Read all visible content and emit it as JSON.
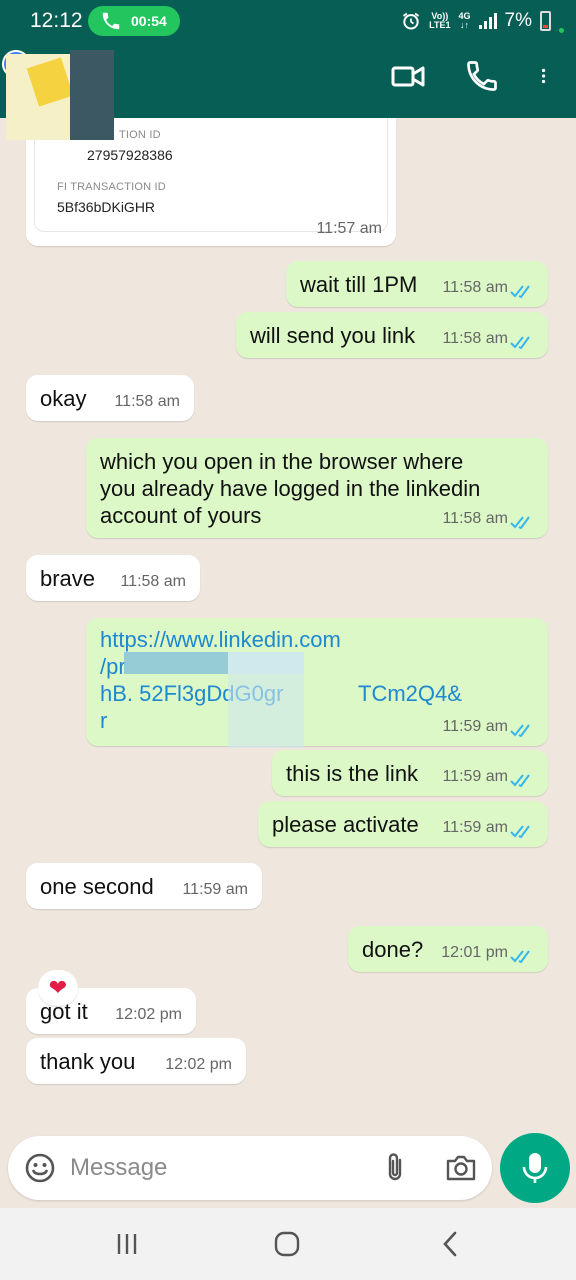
{
  "status_bar": {
    "time": "12:12",
    "call_duration": "00:54",
    "network_top": "Vo))",
    "network_bottom": "LTE1",
    "net_type": "4G",
    "battery": "7%"
  },
  "header": {
    "contact_name": "",
    "icons": [
      "back-icon",
      "video-call-icon",
      "voice-call-icon",
      "more-options-icon"
    ]
  },
  "transaction_card": {
    "label1": "TION ID",
    "value1": "27957928386",
    "label2": "FI TRANSACTION ID",
    "value2": "5Bf36bDKiGHR",
    "time": "11:57 am"
  },
  "messages": [
    {
      "dir": "out",
      "text": "wait till 1PM",
      "time": "11:58 am"
    },
    {
      "dir": "out",
      "text": "will send you link",
      "time": "11:58 am"
    },
    {
      "dir": "in",
      "text": "okay",
      "time": "11:58 am"
    },
    {
      "dir": "out",
      "text": "which you open in the browser where\nyou already have logged in the linkedin\naccount of yours",
      "time": "11:58 am"
    },
    {
      "dir": "in",
      "text": "brave",
      "time": "11:58 am"
    },
    {
      "dir": "out",
      "link_line1": "https://www.linkedin.com",
      "link_line2": "/pr",
      "link_line3a": "hB. 52Fl3gDdG0gr",
      "link_line3b": "TCm2Q4&",
      "link_line4": "r",
      "time": "11:59 am"
    },
    {
      "dir": "out",
      "text": "this is the link",
      "time": "11:59 am"
    },
    {
      "dir": "out",
      "text": "please activate",
      "time": "11:59 am"
    },
    {
      "dir": "in",
      "text": "one second",
      "time": "11:59 am"
    },
    {
      "dir": "out",
      "text": "done?",
      "time": "12:01 pm"
    },
    {
      "dir": "in",
      "text": "got it",
      "time": "12:02 pm"
    },
    {
      "dir": "in",
      "text": "thank you",
      "time": "12:02 pm"
    }
  ],
  "reaction": "❤",
  "input": {
    "placeholder": "Message"
  },
  "colors": {
    "header": "#075e54",
    "outgoing": "#dcf8c6",
    "incoming": "#ffffff",
    "tick": "#34b7f1",
    "mic": "#00a884"
  }
}
